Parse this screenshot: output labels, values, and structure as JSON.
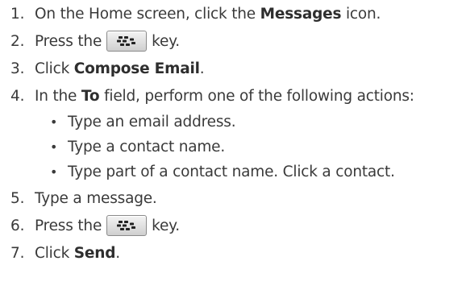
{
  "steps": [
    {
      "num": "1.",
      "pre": "On the Home screen, click the ",
      "bold": "Messages",
      "post": " icon."
    },
    {
      "num": "2.",
      "pre": "Press the ",
      "key": "menu-key",
      "post": " key."
    },
    {
      "num": "3.",
      "pre": "Click ",
      "bold": "Compose Email",
      "post": "."
    },
    {
      "num": "4.",
      "pre": "In the ",
      "bold": "To",
      "post": " field, perform one of the following actions:"
    },
    {
      "num": "5.",
      "text": "Type a message."
    },
    {
      "num": "6.",
      "pre": "Press the ",
      "key": "menu-key",
      "post": " key."
    },
    {
      "num": "7.",
      "pre": "Click ",
      "bold": "Send",
      "post": "."
    }
  ],
  "bullets": [
    "Type an email address.",
    "Type a contact name.",
    "Type part of a contact name. Click a contact."
  ],
  "bullet_glyph": "•",
  "key_icon": "blackberry-menu-icon"
}
